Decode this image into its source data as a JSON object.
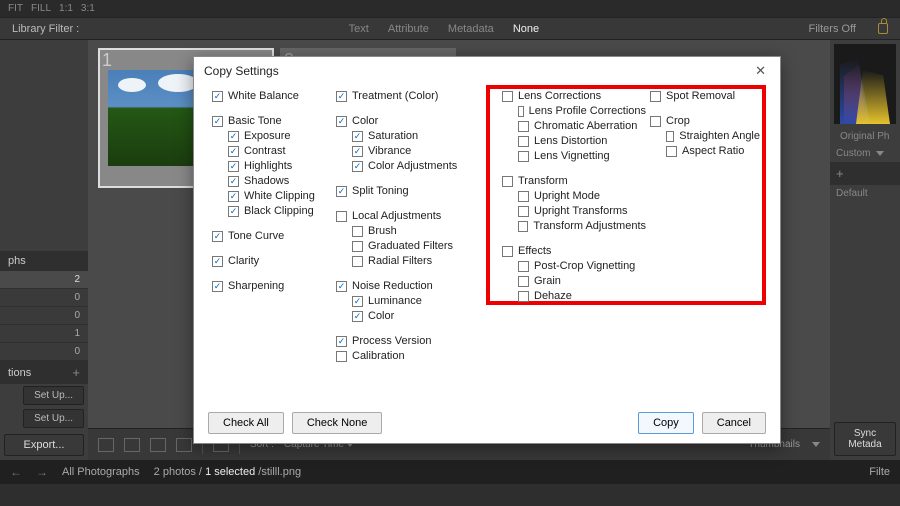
{
  "topbar": {
    "fit": "FIT",
    "fill": "FILL",
    "r11": "1:1",
    "r31": "3:1"
  },
  "filterbar": {
    "label": "Library Filter :",
    "tabs": [
      "Text",
      "Attribute",
      "Metadata",
      "None"
    ],
    "selected": "None",
    "filters_off": "Filters Off"
  },
  "left": {
    "phs": "phs",
    "counts": [
      "2",
      "0",
      "0",
      "1",
      "0"
    ],
    "tions": "tions",
    "setup": "Set Up...",
    "export": "Export..."
  },
  "thumbs": {
    "n1": "1",
    "n2": "2"
  },
  "toolbar": {
    "sort": "Sort :",
    "sortval": "Capture Time",
    "thumbnails": "Thumbnails"
  },
  "right": {
    "orig": "Original Ph",
    "custom": "Custom",
    "default": "Default",
    "sync": "Sync Metada"
  },
  "status": {
    "all": "All Photographs",
    "count": "2 photos /",
    "sel": "1 selected",
    "file": "/stilll.png",
    "filte": "Filte"
  },
  "dialog": {
    "title": "Copy Settings",
    "check_all": "Check All",
    "check_none": "Check None",
    "copy": "Copy",
    "cancel": "Cancel",
    "c0": {
      "wb": "White Balance",
      "bt": "Basic Tone",
      "bt_items": [
        "Exposure",
        "Contrast",
        "Highlights",
        "Shadows",
        "White Clipping",
        "Black Clipping"
      ],
      "tc": "Tone Curve",
      "cl": "Clarity",
      "sh": "Sharpening"
    },
    "c1": {
      "tr": "Treatment (Color)",
      "co": "Color",
      "co_items": [
        "Saturation",
        "Vibrance",
        "Color Adjustments"
      ],
      "st": "Split Toning",
      "la": "Local Adjustments",
      "la_items": [
        "Brush",
        "Graduated Filters",
        "Radial Filters"
      ],
      "nr": "Noise Reduction",
      "nr_items": [
        "Luminance",
        "Color"
      ],
      "pv": "Process Version",
      "cal": "Calibration"
    },
    "c2": {
      "lc": "Lens Corrections",
      "lc_items": [
        "Lens Profile Corrections",
        "Chromatic Aberration",
        "Lens Distortion",
        "Lens Vignetting"
      ],
      "tf": "Transform",
      "tf_items": [
        "Upright Mode",
        "Upright Transforms",
        "Transform Adjustments"
      ],
      "ef": "Effects",
      "ef_items": [
        "Post-Crop Vignetting",
        "Grain",
        "Dehaze"
      ]
    },
    "c3": {
      "sr": "Spot Removal",
      "cr": "Crop",
      "cr_items": [
        "Straighten Angle",
        "Aspect Ratio"
      ]
    }
  }
}
